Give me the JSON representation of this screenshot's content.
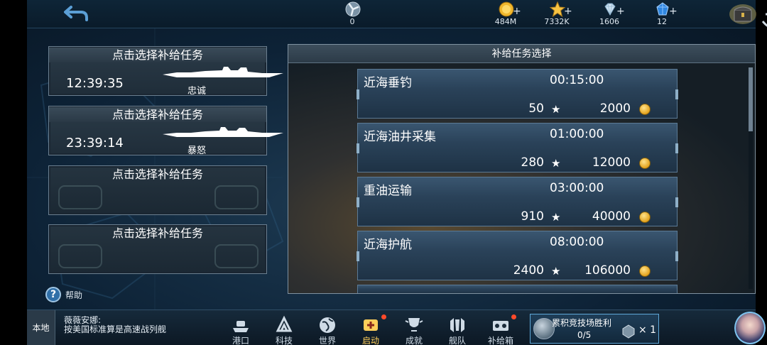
{
  "topbar": {
    "resources": [
      {
        "name": "fuel",
        "value": "0",
        "icon": "propeller-icon",
        "has_plus": false
      },
      {
        "name": "gold",
        "value": "484M",
        "icon": "gold-coin-icon",
        "has_plus": true
      },
      {
        "name": "exp",
        "value": "7332K",
        "icon": "star-icon",
        "has_plus": true
      },
      {
        "name": "diamond",
        "value": "1606",
        "icon": "diamond-icon",
        "has_plus": true
      },
      {
        "name": "gem",
        "value": "12",
        "icon": "blue-gem-icon",
        "has_plus": true
      }
    ],
    "plus_symbol": "+"
  },
  "slots": [
    {
      "title": "点击选择补给任务",
      "timer": "12:39:35",
      "ship": "忠诚"
    },
    {
      "title": "点击选择补给任务",
      "timer": "23:39:14",
      "ship": "暴怒"
    },
    {
      "title": "点击选择补给任务",
      "timer": "",
      "ship": ""
    },
    {
      "title": "点击选择补给任务",
      "timer": "",
      "ship": ""
    }
  ],
  "help_label": "帮助",
  "help_symbol": "?",
  "panel": {
    "title": "补给任务选择",
    "missions": [
      {
        "name": "近海垂钓",
        "time": "00:15:00",
        "exp": "50",
        "gold": "2000"
      },
      {
        "name": "近海油井采集",
        "time": "01:00:00",
        "exp": "280",
        "gold": "12000"
      },
      {
        "name": "重油运输",
        "time": "03:00:00",
        "exp": "910",
        "gold": "40000"
      },
      {
        "name": "近海护航",
        "time": "08:00:00",
        "exp": "2400",
        "gold": "106000"
      }
    ],
    "star_symbol": "★"
  },
  "bottombar": {
    "local_label": "本地",
    "chat_text": "薇薇安娜:\n按美国标准算是高速战列舰",
    "nav": [
      {
        "label": "港口",
        "icon": "harbor-icon",
        "dot": false,
        "active": false
      },
      {
        "label": "科技",
        "icon": "tech-icon",
        "dot": false,
        "active": false
      },
      {
        "label": "世界",
        "icon": "globe-icon",
        "dot": false,
        "active": false
      },
      {
        "label": "启动",
        "icon": "launch-icon",
        "dot": true,
        "active": true
      },
      {
        "label": "成就",
        "icon": "achievement-icon",
        "dot": false,
        "active": false
      },
      {
        "label": "舰队",
        "icon": "fleet-icon",
        "dot": false,
        "active": false
      },
      {
        "label": "补给箱",
        "icon": "supply-box-icon",
        "dot": true,
        "active": false
      }
    ],
    "arena": {
      "title": "累积竞技场胜利",
      "progress": "0/5",
      "reward_count": "× 1"
    }
  },
  "colors": {
    "accent": "#5fa8d8",
    "gold": "#e3a21d",
    "alert": "#ff4a2a"
  }
}
